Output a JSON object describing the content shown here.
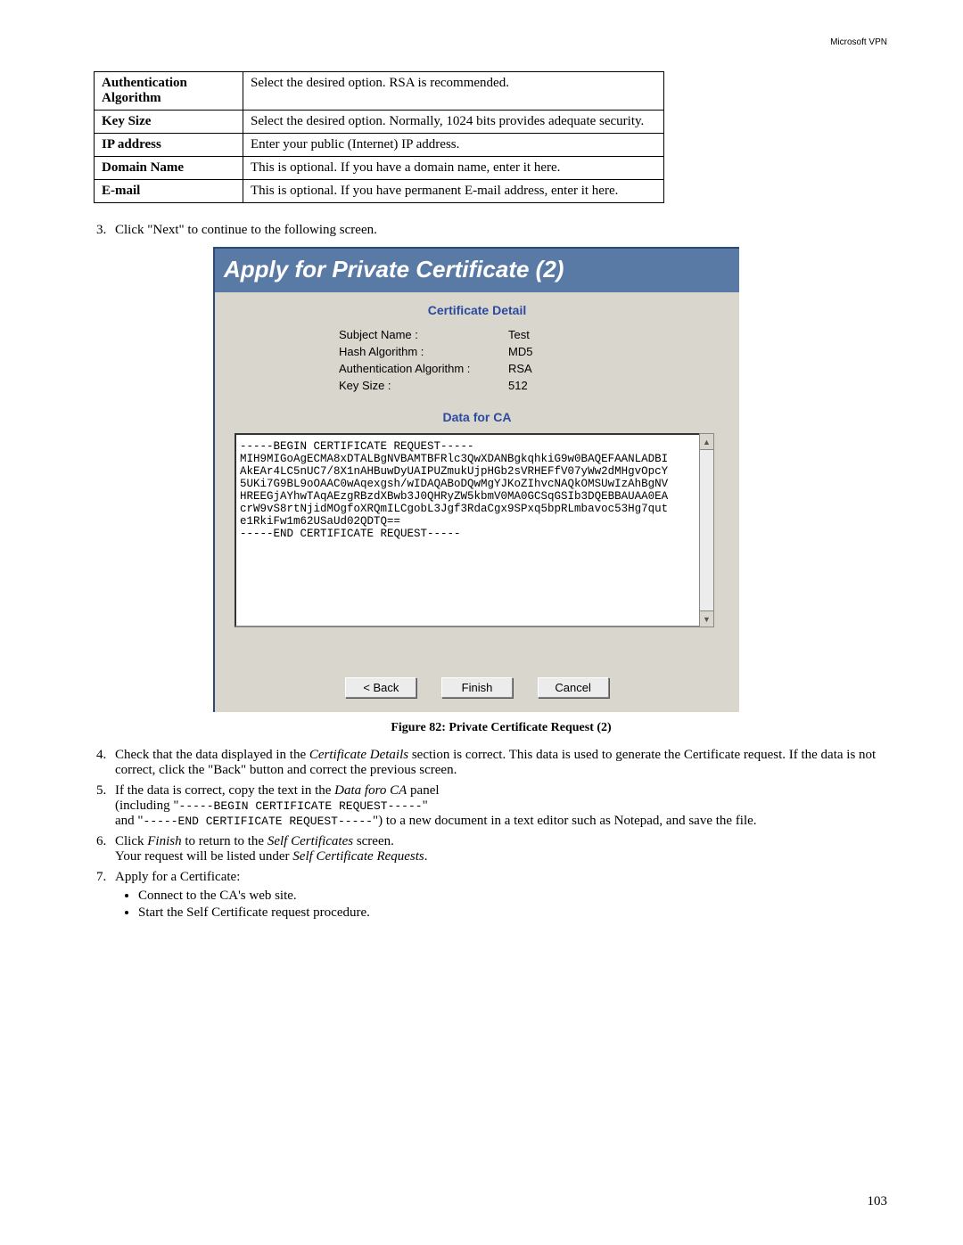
{
  "header": {
    "title": "Microsoft VPN"
  },
  "table_rows": [
    {
      "label": "Authentication Algorithm",
      "desc": "Select the desired option. RSA is recommended."
    },
    {
      "label": "Key Size",
      "desc": "Select the desired option. Normally, 1024 bits provides adequate security."
    },
    {
      "label": "IP address",
      "desc": "Enter your public (Internet) IP address."
    },
    {
      "label": "Domain Name",
      "desc": "This is optional. If you have a domain name, enter it here."
    },
    {
      "label": "E-mail",
      "desc": "This is optional. If you have permanent E-mail address, enter it here."
    }
  ],
  "step3": "Click \"Next\" to continue to the following screen.",
  "figure": {
    "header": "Apply for Private Certificate (2)",
    "section_detail": "Certificate Detail",
    "details": [
      {
        "label": "Subject Name :",
        "value": "Test"
      },
      {
        "label": "Hash Algorithm :",
        "value": "MD5"
      },
      {
        "label": "Authentication Algorithm :",
        "value": "RSA"
      },
      {
        "label": "Key Size :",
        "value": "512"
      }
    ],
    "section_ca": "Data for CA",
    "ca_text": "-----BEGIN CERTIFICATE REQUEST-----\nMIH9MIGoAgECMA8xDTALBgNVBAMTBFRlc3QwXDANBgkqhkiG9w0BAQEFAANLADBI\nAkEAr4LC5nUC7/8X1nAHBuwDyUAIPUZmukUjpHGb2sVRHEFfV07yWw2dMHgvOpcY\n5UKi7G9BL9oOAAC0wAqexgsh/wIDAQABoDQwMgYJKoZIhvcNAQkOMSUwIzAhBgNV\nHREEGjAYhwTAqAEzgRBzdXBwb3J0QHRyZW5kbmV0MA0GCSqGSIb3DQEBBAUAA0EA\ncrW9vS8rtNjidMOgfoXRQmILCgobL3Jgf3RdaCgx9SPxq5bpRLmbavoc53Hg7qut\ne1RkiFw1m62USaUd02QDTQ==\n-----END CERTIFICATE REQUEST-----",
    "buttons": {
      "back": "< Back",
      "finish": "Finish",
      "cancel": "Cancel"
    },
    "caption": "Figure 82: Private Certificate Request (2)"
  },
  "step4": {
    "pre": "Check that the data displayed in the ",
    "em": "Certificate Details",
    "post": " section is correct. This data is used to generate the Certificate request. If the data is not correct, click the \"Back\" button and correct the previous screen."
  },
  "step5": {
    "pre": "If the data is correct, copy the text in the ",
    "em": "Data foro CA",
    "post": " panel",
    "line2_pre": "(including \"",
    "line2_code": "-----BEGIN CERTIFICATE REQUEST-----",
    "line2_post": "\"",
    "line3_pre": "and \"",
    "line3_code": "-----END CERTIFICATE REQUEST-----",
    "line3_post": "\") to a new document in a text editor such as Notepad, and save the file."
  },
  "step6": {
    "l1_pre": "Click ",
    "l1_em1": "Finish",
    "l1_mid": " to return to the ",
    "l1_em2": "Self Certificates",
    "l1_post": " screen.",
    "l2_pre": "Your request will be listed under ",
    "l2_em": "Self Certificate Requests",
    "l2_post": "."
  },
  "step7": {
    "intro": "Apply for a Certificate:",
    "bullets": [
      "Connect to the CA's web site.",
      "Start the Self Certificate request procedure."
    ]
  },
  "page_number": "103"
}
